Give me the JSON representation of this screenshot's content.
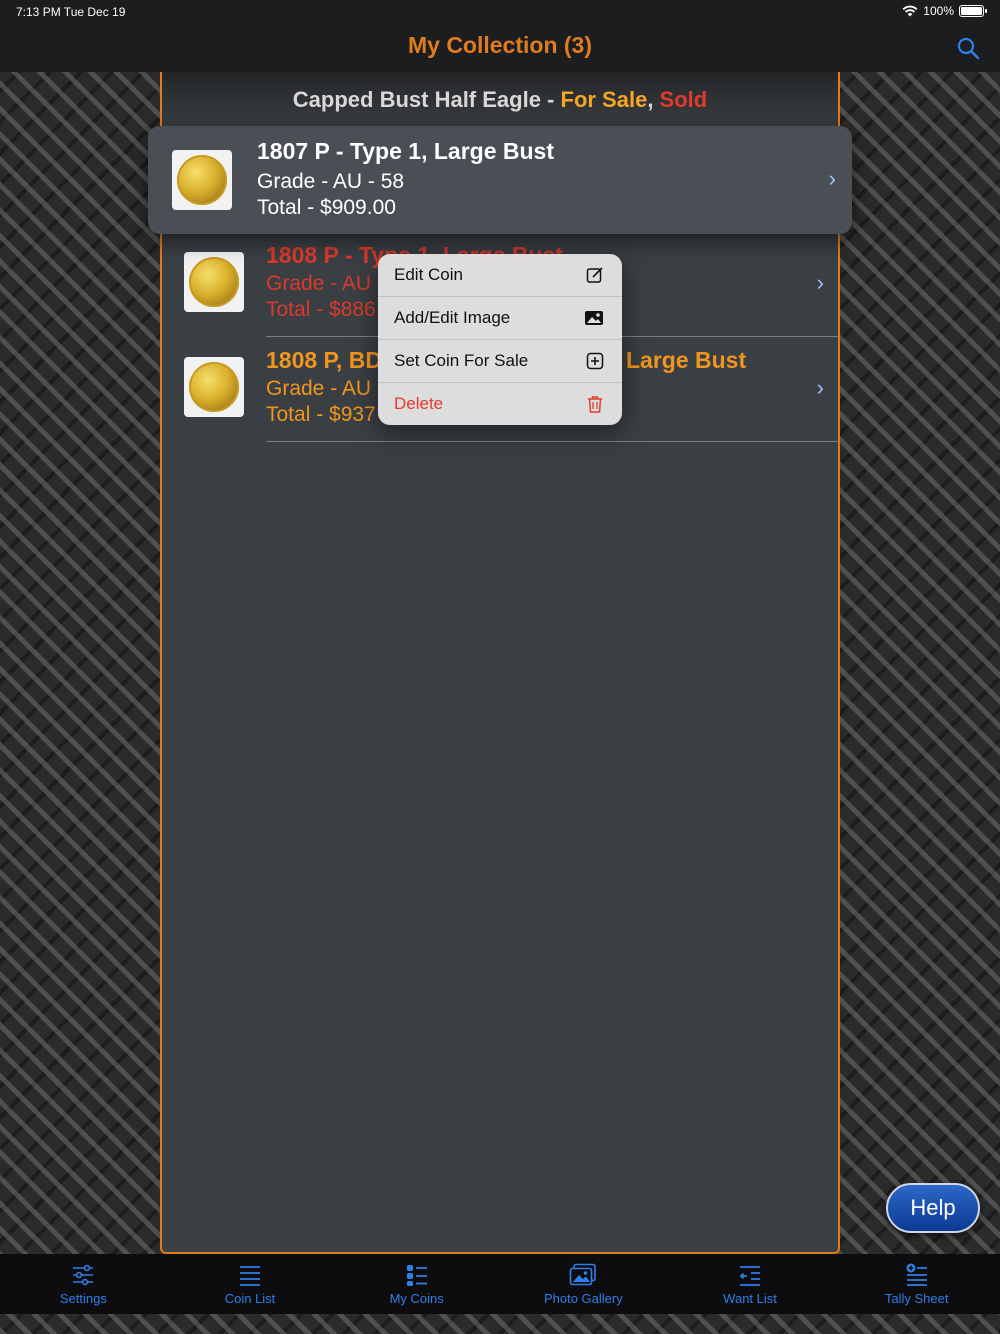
{
  "status_bar": {
    "time": "7:13 PM   Tue Dec 19",
    "battery": "100%"
  },
  "nav": {
    "title": "My Collection (3)"
  },
  "header": {
    "coin_type": "Capped Bust Half Eagle - ",
    "for_sale": "For Sale",
    "comma": ", ",
    "sold": "Sold"
  },
  "lifted_row": {
    "name": "1807 P - Type 1, Large Bust",
    "grade": "Grade - AU - 58",
    "total": "Total - $909.00"
  },
  "rows": [
    {
      "name": "1808 P - Type 1, Large Bust",
      "grade": "Grade - AU",
      "total": "Total - $886",
      "status": "sold"
    },
    {
      "name": "1808 P, BD",
      "name_tail": "Large Bust",
      "grade": "Grade - AU",
      "total": "Total - $937",
      "status": "for-sale"
    }
  ],
  "context_menu": {
    "items": [
      {
        "label": "Edit Coin",
        "icon": "edit-icon"
      },
      {
        "label": "Add/Edit Image",
        "icon": "image-icon"
      },
      {
        "label": "Set Coin For Sale",
        "icon": "plus-square-icon"
      },
      {
        "label": "Delete",
        "icon": "trash-icon"
      }
    ]
  },
  "help": {
    "label": "Help"
  },
  "tabbar": {
    "items": [
      {
        "label": "Settings",
        "icon": "sliders-icon"
      },
      {
        "label": "Coin List",
        "icon": "list-icon"
      },
      {
        "label": "My Coins",
        "icon": "bullet-list-icon"
      },
      {
        "label": "Photo Gallery",
        "icon": "photos-icon"
      },
      {
        "label": "Want List",
        "icon": "want-list-icon"
      },
      {
        "label": "Tally Sheet",
        "icon": "tally-icon"
      }
    ]
  },
  "colors": {
    "accent": "#e07b1e",
    "sold": "#d93a2b",
    "for_sale": "#f0961f",
    "tab": "#2f7fe8"
  }
}
